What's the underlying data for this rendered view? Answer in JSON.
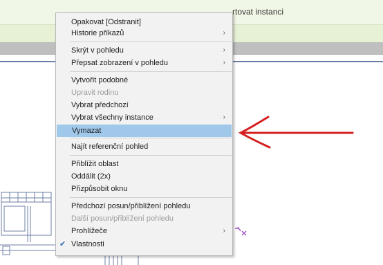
{
  "background": {
    "toolbar_text": "rtovat instanci"
  },
  "menu": {
    "items": [
      {
        "label": "Opakovat [Odstranit]",
        "submenu": false,
        "disabled": false
      },
      {
        "label": "Historie příkazů",
        "submenu": true,
        "disabled": false
      },
      {
        "label": "Skrýt v pohledu",
        "submenu": true,
        "disabled": false
      },
      {
        "label": "Přepsat zobrazení v pohledu",
        "submenu": true,
        "disabled": false
      },
      {
        "label": "Vytvořit podobné",
        "submenu": false,
        "disabled": false
      },
      {
        "label": "Upravit rodinu",
        "submenu": false,
        "disabled": true
      },
      {
        "label": "Vybrat předchozí",
        "submenu": false,
        "disabled": false
      },
      {
        "label": "Vybrat všechny instance",
        "submenu": true,
        "disabled": false
      },
      {
        "label": "Vymazat",
        "submenu": false,
        "disabled": false,
        "highlighted": true
      },
      {
        "label": "Najít referenční pohled",
        "submenu": false,
        "disabled": false
      },
      {
        "label": "Přiblížit oblast",
        "submenu": false,
        "disabled": false
      },
      {
        "label": "Oddálit (2x)",
        "submenu": false,
        "disabled": false
      },
      {
        "label": "Přizpůsobit oknu",
        "submenu": false,
        "disabled": false
      },
      {
        "label": "Předchozí posun/přiblížení pohledu",
        "submenu": false,
        "disabled": false
      },
      {
        "label": "Další posun/přiblížení pohledu",
        "submenu": false,
        "disabled": true
      },
      {
        "label": "Prohlížeče",
        "submenu": true,
        "disabled": false
      },
      {
        "label": "Vlastnosti",
        "submenu": false,
        "disabled": false,
        "checked": true
      }
    ],
    "submenu_glyph": "›",
    "check_glyph": "✔"
  },
  "colors": {
    "highlight": "#9fc8ea",
    "arrow": "#d42020"
  }
}
